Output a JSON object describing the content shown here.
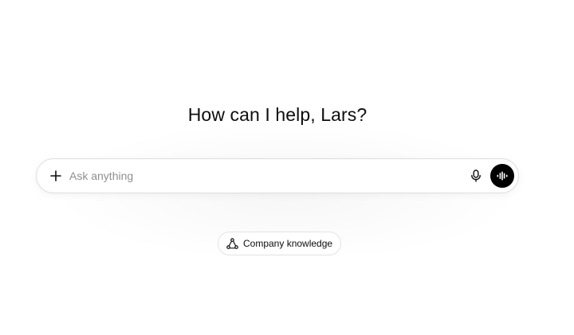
{
  "main": {
    "heading": "How can I help, Lars?"
  },
  "composer": {
    "placeholder": "Ask anything",
    "value": "",
    "icons": {
      "add": "plus-icon",
      "dictate": "microphone-icon",
      "voice_mode": "voice-waveform-icon"
    }
  },
  "suggestions": [
    {
      "label": "Company knowledge",
      "icon": "connectors-icon"
    }
  ],
  "colors": {
    "background": "#ffffff",
    "text": "#0d0d0d",
    "placeholder": "#8f8f8f",
    "voice_button": "#000000",
    "border": "#dedede"
  }
}
